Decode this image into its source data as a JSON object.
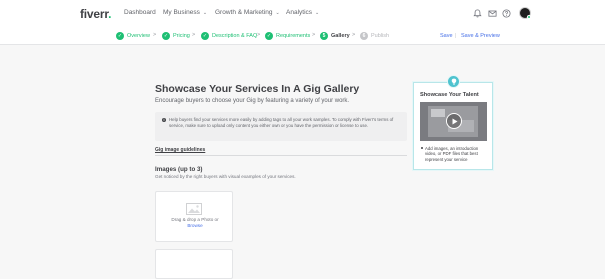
{
  "header": {
    "logo_text": "fiverr",
    "logo_dot": ".",
    "nav": [
      {
        "label": "Dashboard",
        "has_dropdown": false
      },
      {
        "label": "My Business",
        "has_dropdown": true
      },
      {
        "label": "Growth & Marketing",
        "has_dropdown": true
      },
      {
        "label": "Analytics",
        "has_dropdown": true
      }
    ],
    "icons": [
      "bell-icon",
      "mail-icon",
      "help-icon"
    ]
  },
  "stepper": {
    "steps": [
      {
        "number": "1",
        "label": "Overview",
        "state": "done"
      },
      {
        "number": "2",
        "label": "Pricing",
        "state": "done"
      },
      {
        "number": "3",
        "label": "Description & FAQ",
        "state": "done"
      },
      {
        "number": "4",
        "label": "Requirements",
        "state": "done"
      },
      {
        "number": "5",
        "label": "Gallery",
        "state": "active"
      },
      {
        "number": "6",
        "label": "Publish",
        "state": "pending"
      }
    ],
    "separator": ">",
    "save_label": "Save",
    "divider": "|",
    "preview_label": "Save & Preview"
  },
  "main": {
    "title": "Showcase Your Services In A Gig Gallery",
    "subtitle": "Encourage buyers to choose your Gig by featuring a variety of your work.",
    "info_icon": "i",
    "info_text": "Help buyers find your services more easily by adding tags to all your work samples. To comply with Fiverr's terms of service, make sure to upload only content you either own or you have the permission or license to use.",
    "guidelines_link": "Gig image guidelines",
    "images_heading": "Images (up to 3)",
    "images_subtext": "Get noticed by the right buyers with visual examples of your services.",
    "dropzone_text": "Drag & drop a Photo or",
    "dropzone_link": "Browse"
  },
  "showcase": {
    "title": "Showcase Your Talent",
    "tip": "Add images, an introduction video, or PDF files that best represent your service"
  },
  "colors": {
    "brand_green": "#1dbf73",
    "link_blue": "#446ee7",
    "tip_teal": "#4fc3cf",
    "text_dark": "#404145",
    "page_bg": "#f7f7f7"
  }
}
